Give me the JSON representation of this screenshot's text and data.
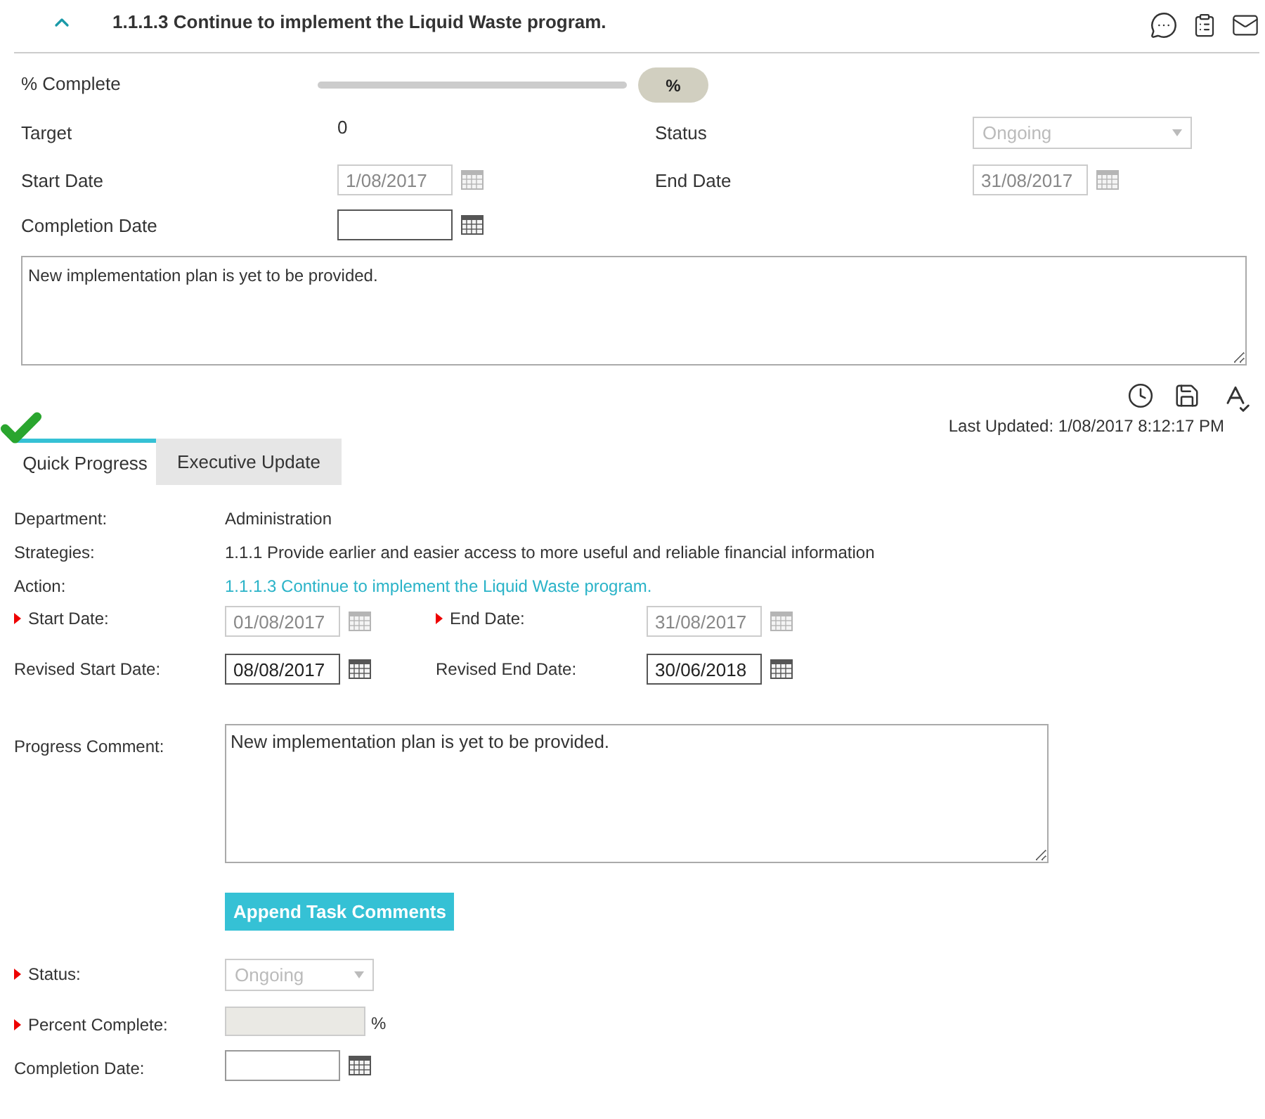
{
  "header": {
    "title": "1.1.1.3 Continue to implement the Liquid Waste program.",
    "expanded": true
  },
  "summary": {
    "percent_complete": {
      "label": "% Complete",
      "level": 0,
      "unit": "%"
    },
    "target": {
      "label": "Target",
      "value": "0"
    },
    "status": {
      "label": "Status",
      "value": "Ongoing",
      "disabled": true
    },
    "start_date": {
      "label": "Start Date",
      "value": "1/08/2017",
      "disabled": true
    },
    "end_date": {
      "label": "End Date",
      "value": "31/08/2017",
      "disabled": true
    },
    "completion_date": {
      "label": "Completion Date",
      "disabled": false
    },
    "comment": "New implementation plan is yet to be provided."
  },
  "last_updated": "Last Updated: 1/08/2017 8:12:17 PM",
  "tabs": [
    {
      "label": "Quick Progress",
      "selected": true,
      "done": true
    },
    {
      "label": "Executive Update",
      "selected": false,
      "done": false
    }
  ],
  "quick_progress": {
    "department": {
      "label": "Department:",
      "value": "Administration"
    },
    "strategies": {
      "label": "Strategies:",
      "value": "1.1.1 Provide earlier and easier access to more useful and reliable financial information"
    },
    "action": {
      "label": "Action:",
      "value": "1.1.1.3 Continue to implement the Liquid Waste program."
    },
    "start_date": {
      "label": "Start Date:",
      "value": "01/08/2017",
      "required": true,
      "disabled": true
    },
    "end_date": {
      "label": "End Date:",
      "value": "31/08/2017",
      "required": true,
      "disabled": true
    },
    "revised_start_date": {
      "label": "Revised Start Date:",
      "value": "08/08/2017",
      "required": false,
      "disabled": false
    },
    "revised_end_date": {
      "label": "Revised End Date:",
      "value": "30/06/2018",
      "required": false,
      "disabled": false
    },
    "progress_comment": {
      "label": "Progress Comment:",
      "value": "New implementation plan is yet to be provided."
    },
    "append_button": "Append Task Comments",
    "status": {
      "label": "Status:",
      "value": "Ongoing",
      "required": true,
      "disabled": true
    },
    "percent_complete": {
      "label": "Percent Complete:",
      "unit": "%",
      "required": true,
      "disabled": true
    },
    "completion_date": {
      "label": "Completion Date:",
      "required": false,
      "disabled": false
    }
  }
}
